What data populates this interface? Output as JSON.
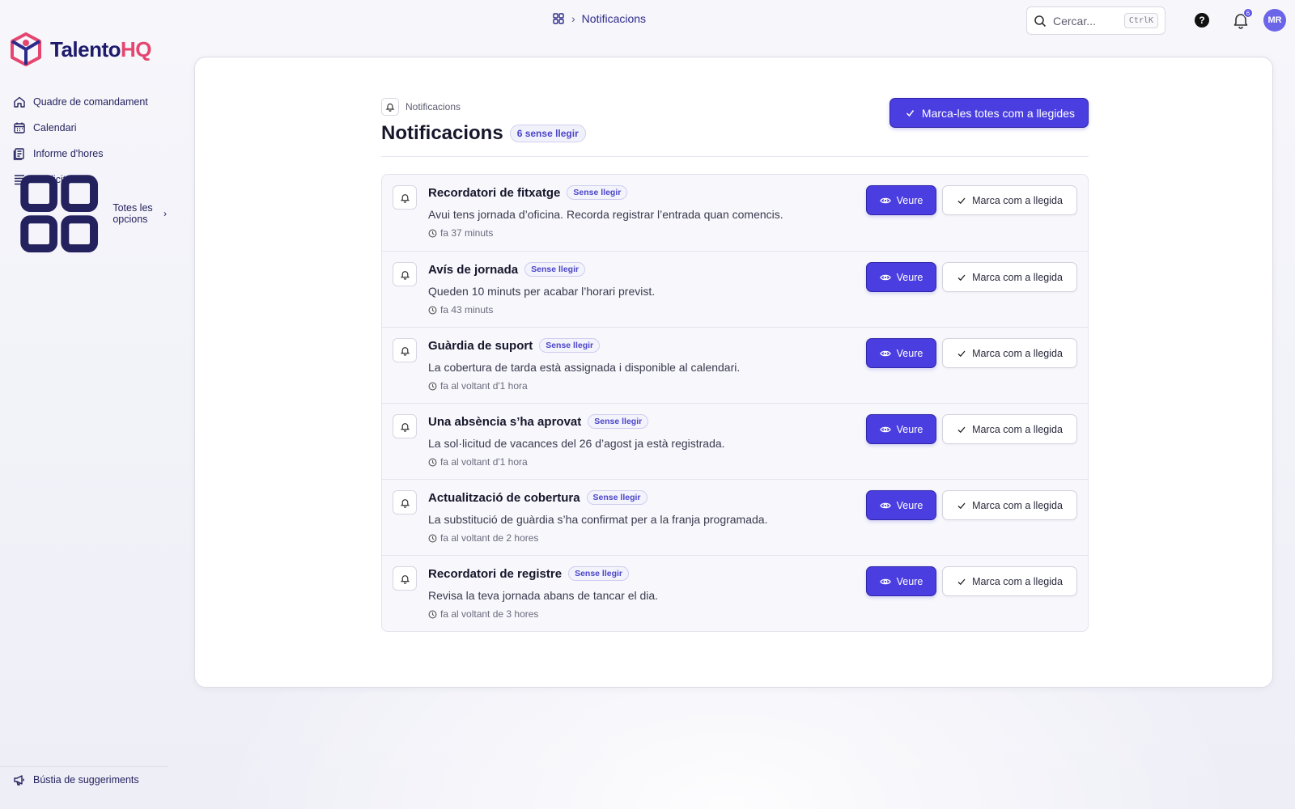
{
  "app": {
    "logo_part1": "Talento",
    "logo_part2": "HQ",
    "brand_color": "#1e1b6b",
    "accent_color": "#e5466f",
    "primary_button_color": "#4a3ee0"
  },
  "sidebar": {
    "items": [
      {
        "label": "Quadre de comandament",
        "icon": "home-icon"
      },
      {
        "label": "Calendari",
        "icon": "calendar-icon"
      },
      {
        "label": "Informe d'hores",
        "icon": "report-icon"
      },
      {
        "label": "Sol·licituds",
        "icon": "list-icon"
      }
    ],
    "more_label": "Totes les opcions",
    "feedback_label": "Bústia de suggeriments"
  },
  "topbar": {
    "breadcrumb": "Notificacions",
    "search_placeholder": "Cercar...",
    "search_shortcut": "CtrlK",
    "help_glyph": "?",
    "notification_count": "6",
    "avatar_initials": "MR"
  },
  "page": {
    "breadcrumb": "Notificacions",
    "title": "Notificacions",
    "unread_count_label": "6 sense llegir",
    "mark_all_label": "Marca-les totes com a llegides"
  },
  "notifications": [
    {
      "title": "Recordatori de fitxatge",
      "badge": "Sense llegir",
      "description": "Avui tens jornada d’oficina. Recorda registrar l’entrada quan comencis.",
      "time": "fa 37 minuts",
      "view_label": "Veure",
      "mark_label": "Marca com a llegida"
    },
    {
      "title": "Avís de jornada",
      "badge": "Sense llegir",
      "description": "Queden 10 minuts per acabar l’horari previst.",
      "time": "fa 43 minuts",
      "view_label": "Veure",
      "mark_label": "Marca com a llegida"
    },
    {
      "title": "Guàrdia de suport",
      "badge": "Sense llegir",
      "description": "La cobertura de tarda està assignada i disponible al calendari.",
      "time": "fa al voltant d'1 hora",
      "view_label": "Veure",
      "mark_label": "Marca com a llegida"
    },
    {
      "title": "Una absència s’ha aprovat",
      "badge": "Sense llegir",
      "description": "La sol·licitud de vacances del 26 d’agost ja està registrada.",
      "time": "fa al voltant d'1 hora",
      "view_label": "Veure",
      "mark_label": "Marca com a llegida"
    },
    {
      "title": "Actualització de cobertura",
      "badge": "Sense llegir",
      "description": "La substitució de guàrdia s’ha confirmat per a la franja programada.",
      "time": "fa al voltant de 2 hores",
      "view_label": "Veure",
      "mark_label": "Marca com a llegida"
    },
    {
      "title": "Recordatori de registre",
      "badge": "Sense llegir",
      "description": "Revisa la teva jornada abans de tancar el dia.",
      "time": "fa al voltant de 3 hores",
      "view_label": "Veure",
      "mark_label": "Marca com a llegida"
    }
  ]
}
